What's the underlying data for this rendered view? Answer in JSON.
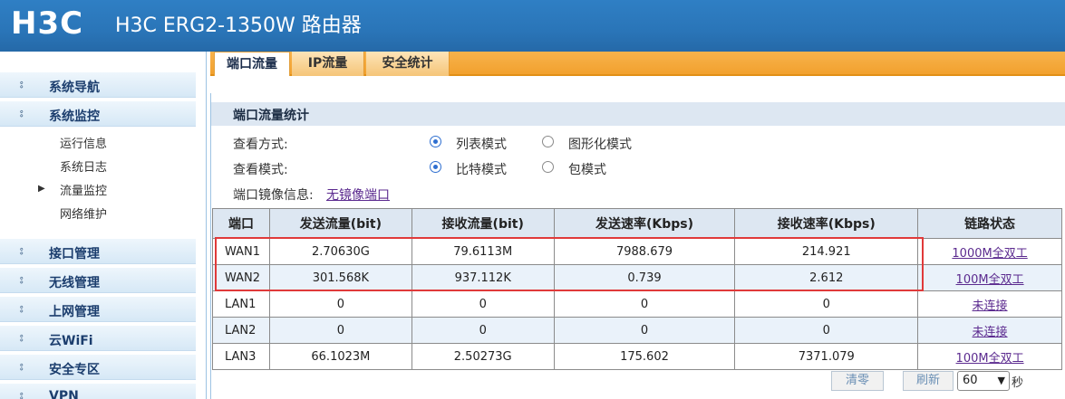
{
  "header": {
    "logo": "H3C",
    "title": "H3C ERG2-1350W 路由器"
  },
  "sidebar": {
    "sections": [
      {
        "label": "系统导航",
        "arrow": "⦂"
      },
      {
        "label": "系统监控",
        "arrow": "⦂"
      },
      {
        "label": "接口管理",
        "arrow": "⦂"
      },
      {
        "label": "无线管理",
        "arrow": "⦂"
      },
      {
        "label": "上网管理",
        "arrow": "⦂"
      },
      {
        "label": "云WiFi",
        "arrow": "⦂"
      },
      {
        "label": "安全专区",
        "arrow": "⦂"
      },
      {
        "label": "VPN",
        "arrow": "⦂"
      }
    ],
    "sub_items": [
      "运行信息",
      "系统日志",
      "流量监控",
      "网络维护"
    ]
  },
  "tabs": [
    "端口流量",
    "IP流量",
    "安全统计"
  ],
  "panel": {
    "title": "端口流量统计",
    "view_mode_label": "查看方式:",
    "view_mode_options": [
      "列表模式",
      "图形化模式"
    ],
    "view_type_label": "查看模式:",
    "view_type_options": [
      "比特模式",
      "包模式"
    ],
    "mirror_label": "端口镜像信息:",
    "mirror_value": "无镜像端口"
  },
  "table": {
    "headers": [
      "端口",
      "发送流量(bit)",
      "接收流量(bit)",
      "发送速率(Kbps)",
      "接收速率(Kbps)",
      "链路状态"
    ],
    "rows": [
      [
        "WAN1",
        "2.70630G",
        "79.6113M",
        "7988.679",
        "214.921",
        "1000M全双工"
      ],
      [
        "WAN2",
        "301.568K",
        "937.112K",
        "0.739",
        "2.612",
        "100M全双工"
      ],
      [
        "LAN1",
        "0",
        "0",
        "0",
        "0",
        "未连接"
      ],
      [
        "LAN2",
        "0",
        "0",
        "0",
        "0",
        "未连接"
      ],
      [
        "LAN3",
        "66.1023M",
        "2.50273G",
        "175.602",
        "7371.079",
        "100M全双工"
      ]
    ]
  },
  "controls": {
    "clear_label": "清零",
    "refresh_label": "刷新",
    "interval_value": "60",
    "interval_unit": "秒"
  },
  "colors": {
    "header": "#2a75b8",
    "tab_bar": "#f2a12e",
    "highlight": "#e03a3a",
    "link": "#5b2a8f"
  }
}
